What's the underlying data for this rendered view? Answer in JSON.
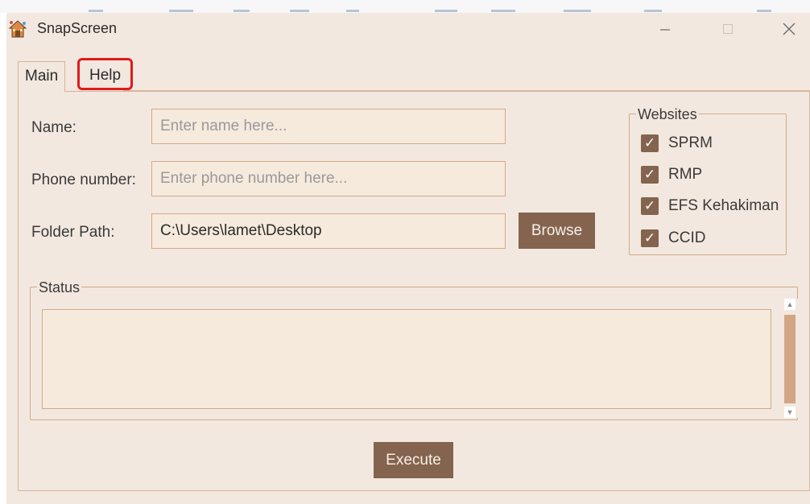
{
  "window": {
    "title": "SnapScreen"
  },
  "tabs": {
    "main": "Main",
    "help": "Help"
  },
  "form": {
    "name_label": "Name:",
    "name_placeholder": "Enter name here...",
    "phone_label": "Phone number:",
    "phone_placeholder": "Enter phone number here...",
    "folder_label": "Folder Path:",
    "folder_value": "C:\\Users\\lamet\\Desktop",
    "browse_label": "Browse"
  },
  "websites": {
    "legend": "Websites",
    "items": [
      {
        "label": "SPRM",
        "checked": true
      },
      {
        "label": "RMP",
        "checked": true
      },
      {
        "label": "EFS Kehakiman",
        "checked": true
      },
      {
        "label": "CCID",
        "checked": true
      }
    ],
    "check_glyph": "✓"
  },
  "status": {
    "legend": "Status",
    "text": ""
  },
  "actions": {
    "execute_label": "Execute"
  },
  "icons": {
    "app": "house-icon",
    "minimize": "minimize-icon",
    "maximize": "maximize-icon",
    "close": "close-icon"
  },
  "colors": {
    "window_bg": "#f2e8df",
    "field_bg": "#f5eadc",
    "border": "#d3a98a",
    "button_bg": "#84644f",
    "highlight": "#e01b1b"
  }
}
